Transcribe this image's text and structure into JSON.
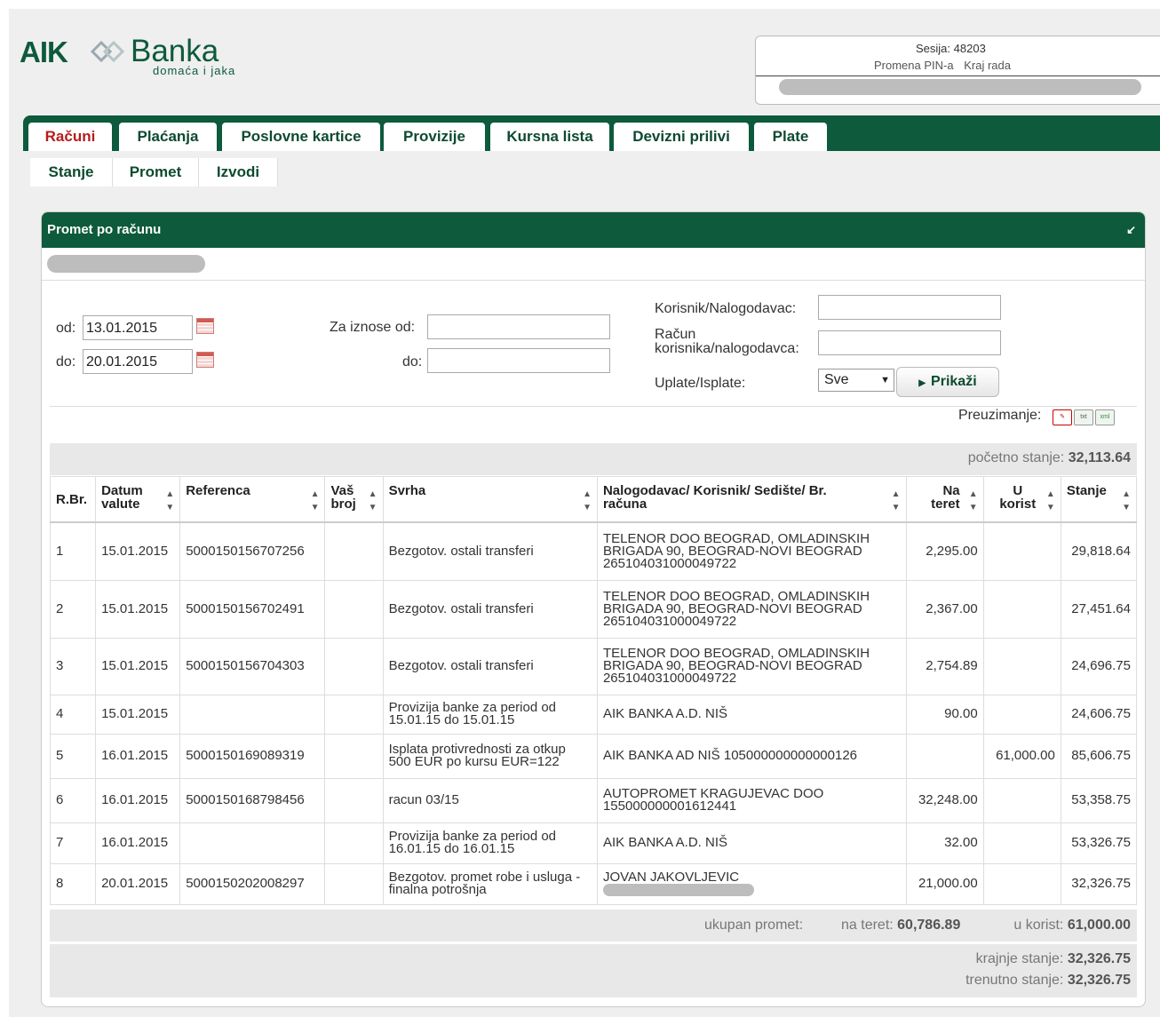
{
  "brand": {
    "name_bold": "AIK",
    "name": "Banka",
    "tagline": "domaća i jaka"
  },
  "session": {
    "label": "Sesija:",
    "id": "48203",
    "change_pin": "Promena PIN-a",
    "logout": "Kraj rada"
  },
  "main_tabs": [
    "Računi",
    "Plaćanja",
    "Poslovne kartice",
    "Provizije",
    "Kursna lista",
    "Devizni prilivi",
    "Plate"
  ],
  "sub_tabs": [
    "Stanje",
    "Promet",
    "Izvodi"
  ],
  "panel": {
    "title": "Promet po računu"
  },
  "filters": {
    "from_label": "od:",
    "from_value": "13.01.2015",
    "to_label": "do:",
    "to_value": "20.01.2015",
    "amount_from_label": "Za iznose od:",
    "amount_to_label": "do:",
    "user_label": "Korisnik/Nalogodavac:",
    "account_label_1": "Račun",
    "account_label_2": "korisnika/nalogodavca:",
    "type_label": "Uplate/Isplate:",
    "type_value": "Sve",
    "show_button": "Prikaži"
  },
  "download": {
    "label": "Preuzimanje:",
    "icons": [
      "pdf-icon",
      "txt-icon",
      "xml-icon"
    ]
  },
  "opening": {
    "label": "početno stanje:",
    "value": "32,113.64"
  },
  "table": {
    "headers": [
      "R.Br.",
      "Datum valute",
      "Referenca",
      "Vaš broj",
      "Svrha",
      "Nalogodavac/ Korisnik/ Sedište/ Br. računa",
      "Na teret",
      "U korist",
      "Stanje"
    ],
    "rows": [
      {
        "n": "1",
        "date": "15.01.2015",
        "ref": "5000150156707256",
        "svrha": "Bezgotov. ostali transferi",
        "party": "TELENOR DOO BEOGRAD, OMLADINSKIH BRIGADA 90, BEOGRAD-NOVI BEOGRAD 265104031000049722",
        "debit": "2,295.00",
        "credit": "",
        "balance": "29,818.64"
      },
      {
        "n": "2",
        "date": "15.01.2015",
        "ref": "5000150156702491",
        "svrha": "Bezgotov. ostali transferi",
        "party": "TELENOR DOO BEOGRAD, OMLADINSKIH BRIGADA 90, BEOGRAD-NOVI BEOGRAD 265104031000049722",
        "debit": "2,367.00",
        "credit": "",
        "balance": "27,451.64"
      },
      {
        "n": "3",
        "date": "15.01.2015",
        "ref": "5000150156704303",
        "svrha": "Bezgotov. ostali transferi",
        "party": "TELENOR DOO BEOGRAD, OMLADINSKIH BRIGADA 90, BEOGRAD-NOVI BEOGRAD 265104031000049722",
        "debit": "2,754.89",
        "credit": "",
        "balance": "24,696.75"
      },
      {
        "n": "4",
        "date": "15.01.2015",
        "ref": "",
        "svrha": "Provizija banke za period od 15.01.15 do 15.01.15",
        "party": "AIK BANKA A.D. NIŠ",
        "debit": "90.00",
        "credit": "",
        "balance": "24,606.75"
      },
      {
        "n": "5",
        "date": "16.01.2015",
        "ref": "5000150169089319",
        "svrha": "Isplata protivrednosti za otkup 500 EUR po kursu EUR=122",
        "party": "AIK BANKA AD NIŠ 105000000000000126",
        "debit": "",
        "credit": "61,000.00",
        "balance": "85,606.75"
      },
      {
        "n": "6",
        "date": "16.01.2015",
        "ref": "5000150168798456",
        "svrha": "racun 03/15",
        "party": "AUTOPROMET KRAGUJEVAC DOO 155000000001612441",
        "debit": "32,248.00",
        "credit": "",
        "balance": "53,358.75"
      },
      {
        "n": "7",
        "date": "16.01.2015",
        "ref": "",
        "svrha": "Provizija banke za period od 16.01.15 do 16.01.15",
        "party": "AIK BANKA A.D. NIŠ",
        "debit": "32.00",
        "credit": "",
        "balance": "53,326.75"
      },
      {
        "n": "8",
        "date": "20.01.2015",
        "ref": "5000150202008297",
        "svrha": "Bezgotov. promet robe i usluga - finalna potrošnja",
        "party": "JOVAN JAKOVLJEVIC",
        "debit": "21,000.00",
        "credit": "",
        "balance": "32,326.75"
      }
    ]
  },
  "totals": {
    "total_label": "ukupan promet:",
    "debit_label": "na teret:",
    "debit_value": "60,786.89",
    "credit_label": "u korist:",
    "credit_value": "61,000.00",
    "closing_label": "krajnje stanje:",
    "closing_value": "32,326.75",
    "current_label": "trenutno stanje:",
    "current_value": "32,326.75"
  }
}
